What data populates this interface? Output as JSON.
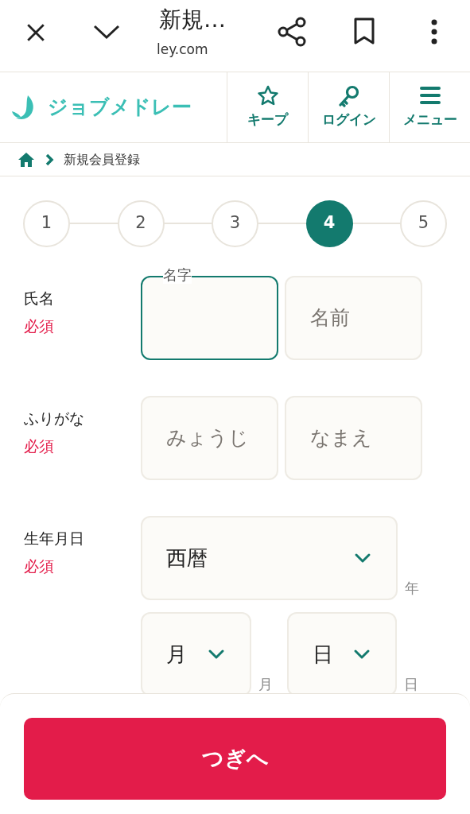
{
  "browser_bar": {
    "title": "新規…",
    "url": "ley.com"
  },
  "header": {
    "logo": "ジョブメドレー",
    "nav": [
      {
        "kind": "star",
        "label": "キープ"
      },
      {
        "kind": "key",
        "label": "ログイン"
      },
      {
        "kind": "menu",
        "label": "メニュー"
      }
    ]
  },
  "breadcrumb": {
    "current": "新規会員登録"
  },
  "steps": [
    {
      "label": "1",
      "selected": false
    },
    {
      "label": "2",
      "selected": false
    },
    {
      "label": "3",
      "selected": false
    },
    {
      "label": "4",
      "selected": true
    },
    {
      "label": "5",
      "selected": false
    }
  ],
  "form": [
    {
      "label": "氏名",
      "required": "必須",
      "fields": [
        {
          "placeholder": "名字",
          "focused": true
        },
        {
          "placeholder": "名前",
          "focused": false
        }
      ]
    },
    {
      "label": "ふりがな",
      "required": "必須",
      "fields": [
        {
          "placeholder": "みょうじ",
          "focused": false
        },
        {
          "placeholder": "なまえ",
          "focused": false
        }
      ]
    }
  ],
  "birthday": {
    "label": "生年月日",
    "required": "必須",
    "era": {
      "value": "西暦",
      "suffix": "年"
    },
    "month": {
      "value": "月",
      "suffix": "月"
    },
    "day": {
      "value": "日",
      "suffix": "日"
    }
  },
  "next_button": "つぎへ"
}
